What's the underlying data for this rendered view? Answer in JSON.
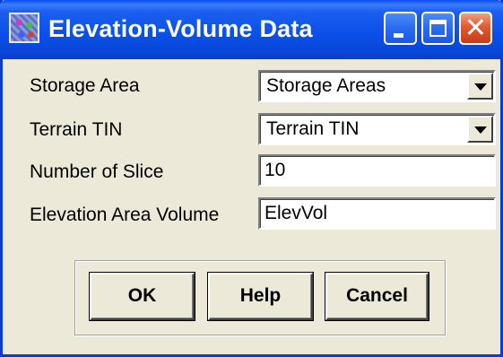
{
  "window": {
    "title": "Elevation-Volume Data",
    "icon": "arcview-app-icon",
    "controls": {
      "minimize": "minimize-icon",
      "maximize": "maximize-icon",
      "close": "close-icon",
      "close_glyph": "✕"
    },
    "colors": {
      "titlebar": "#0a4fe8",
      "face": "#ece9d8",
      "close_button": "#e25a30"
    }
  },
  "form": {
    "storage_area": {
      "label": "Storage Area",
      "selected": "Storage Areas"
    },
    "terrain_tin": {
      "label": "Terrain TIN",
      "selected": "Terrain TIN"
    },
    "number_of_slice": {
      "label": "Number of Slice",
      "value": "10"
    },
    "elevation_area_volume": {
      "label": "Elevation Area Volume",
      "value": "ElevVol"
    }
  },
  "buttons": {
    "ok": "OK",
    "help": "Help",
    "cancel": "Cancel"
  }
}
